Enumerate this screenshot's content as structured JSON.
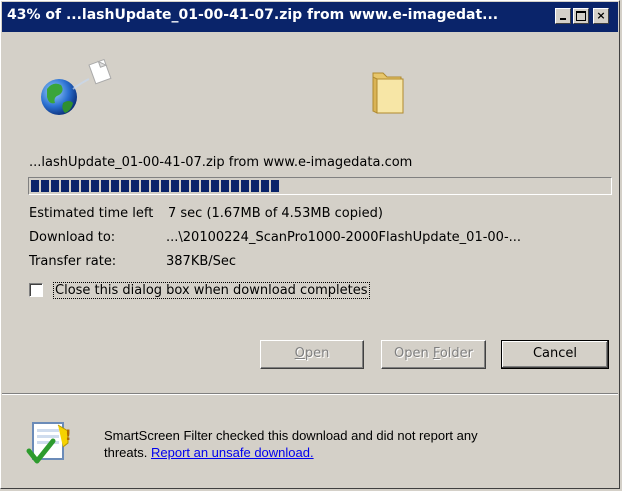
{
  "window": {
    "title": "43% of ...lashUpdate_01-00-41-07.zip from www.e-imagedat...",
    "controls": {
      "minimize": "minimize-icon",
      "maximize": "maximize-icon",
      "close": "×"
    }
  },
  "icons": {
    "source": "globe-icon",
    "destination": "folder-icon",
    "smartscreen": "shield-check-icon"
  },
  "download": {
    "file_label": "...lashUpdate_01-00-41-07.zip from www.e-imagedata.com",
    "progress_fraction": 0.43,
    "estimated_label": "Estimated time left",
    "estimated_value": "7 sec (1.67MB of 4.53MB copied)",
    "download_to_label": "Download to:",
    "download_to_value": "...\\20100224_ScanPro1000-2000FlashUpdate_01-00-...",
    "transfer_label": "Transfer rate:",
    "transfer_value": "387KB/Sec"
  },
  "close_checkbox": {
    "label": "Close this dialog box when download completes",
    "checked": false
  },
  "buttons": {
    "open": {
      "accel": "O",
      "rest": "pen"
    },
    "open_folder": {
      "pre": "Open ",
      "accel": "F",
      "rest": "older"
    },
    "cancel": "Cancel"
  },
  "smartscreen": {
    "line1": "SmartScreen Filter checked this download and did not report any",
    "line2_prefix": "threats.",
    "link": "Report an unsafe download."
  }
}
